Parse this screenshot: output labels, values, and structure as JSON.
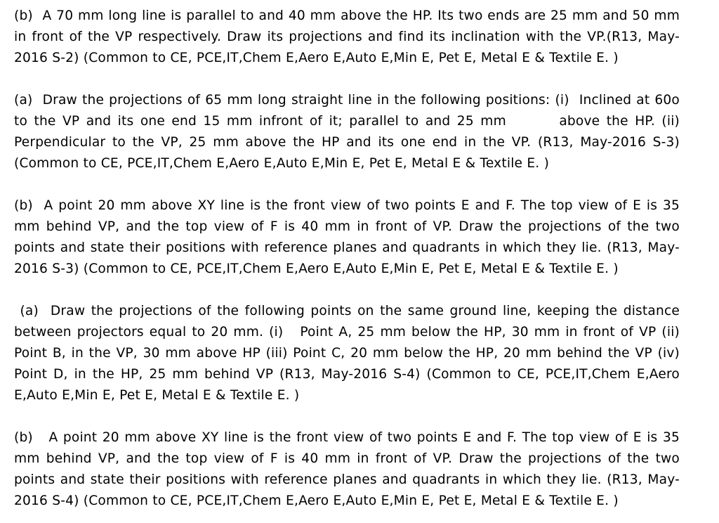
{
  "document": {
    "type": "exam-question-sheet",
    "subject_hint": "Engineering Drawing - Projections of Points and Lines",
    "text_color": "#000000",
    "background_color": "#ffffff",
    "paragraphs": [
      {
        "id": "q-2b",
        "label": "(b)",
        "text": "(b)  A 70 mm long line is parallel to and 40 mm above the HP. Its two ends are 25 mm and 50 mm in front of the VP respectively. Draw its projections and find its inclination with the VP.(R13, May-2016 S-2) (Common to CE, PCE,IT,Chem E,Aero E,Auto E,Min E, Pet E, Metal E & Textile E. )"
      },
      {
        "id": "q-3a",
        "label": "(a)",
        "text": "(a)  Draw the projections of 65 mm long straight line in the following positions: (i)  Inclined at 60o to the VP and its one end 15 mm infront of it; parallel to and 25 mm        above the HP. (ii) Perpendicular to the VP, 25 mm above the HP and its one end in the VP. (R13, May-2016 S-3) (Common to CE, PCE,IT,Chem E,Aero E,Auto E,Min E, Pet E, Metal E & Textile E. )"
      },
      {
        "id": "q-3b",
        "label": "(b)",
        "text": "(b)  A point 20 mm above XY line is the front view of two points E and F. The top view of E is 35 mm behind VP, and the top view of F is 40 mm in front of VP. Draw the projections of the two points and state their positions with reference planes and quadrants in which they lie. (R13, May-2016 S-3) (Common to CE, PCE,IT,Chem E,Aero E,Auto E,Min E, Pet E, Metal E & Textile E. )"
      },
      {
        "id": "q-4a",
        "label": "(a)",
        "text": " (a)  Draw the projections of the following points on the same ground line, keeping the distance between projectors equal to 20 mm. (i)   Point A, 25 mm below the HP, 30 mm in front of VP (ii) Point B, in the VP, 30 mm above HP (iii) Point C, 20 mm below the HP, 20 mm behind the VP (iv) Point D, in the HP, 25 mm behind VP (R13, May-2016 S-4) (Common to CE, PCE,IT,Chem E,Aero E,Auto E,Min E, Pet E, Metal E & Textile E. )"
      },
      {
        "id": "q-4b",
        "label": "(b)",
        "text": "(b)   A point 20 mm above XY line is the front view of two points E and F. The top view of E is 35 mm behind VP, and the top view of F is 40 mm in front of VP. Draw the projections of the two points and state their positions with reference planes and quadrants in which they lie. (R13, May-2016 S-4) (Common to CE, PCE,IT,Chem E,Aero E,Auto E,Min E, Pet E, Metal E & Textile E. )"
      }
    ]
  }
}
